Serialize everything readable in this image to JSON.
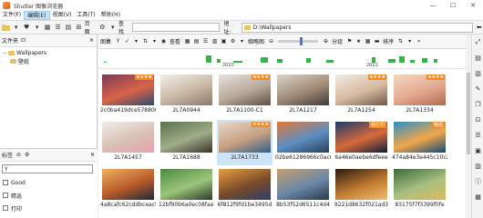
{
  "window": {
    "title": "Shutter 图像浏览器",
    "controls": [
      "—",
      "☐",
      "✕"
    ]
  },
  "menu": [
    "文件(F)",
    "编辑(E)",
    "视图(V)",
    "工具(T)",
    "帮助(H)"
  ],
  "toolbar": {
    "open_label": "",
    "slideshow_label": "",
    "group_label": "页面",
    "search_label": "查找",
    "address_label": "地址:",
    "address_value": "D:\\Wallpapers"
  },
  "folders": {
    "header": "文件夹",
    "items": [
      {
        "label": "Wallpapers",
        "level": 0
      },
      {
        "label": "壁纸",
        "level": 1
      }
    ]
  },
  "tags": {
    "header": "标签",
    "input_value": "",
    "items": [
      {
        "label": "Good"
      },
      {
        "label": "精选"
      },
      {
        "label": "打印"
      }
    ]
  },
  "view_toolbar": {
    "group_label": "图集",
    "view_label": "查看",
    "zoom_label": "缩略图",
    "group2_label": "分组",
    "sort_label": "排序"
  },
  "timeline": {
    "years": [
      "2020",
      "2021"
    ]
  },
  "thumbnails": [
    {
      "caption": "2c0ba419dce578800",
      "colors": [
        "#7a3b55",
        "#d9634a",
        "#2a4a6b"
      ],
      "stars": "★★★★"
    },
    {
      "caption": "2L7A0944",
      "colors": [
        "#f2efe9",
        "#c9b7a5",
        "#8a7a6a"
      ],
      "stars": ""
    },
    {
      "caption": "2L7A1100-C1",
      "colors": [
        "#e8e2dc",
        "#b8a89a",
        "#5e5048"
      ],
      "stars": "★★★★"
    },
    {
      "caption": "2L7A1217",
      "colors": [
        "#dcd3c8",
        "#a08a76",
        "#3e3a38"
      ],
      "stars": ""
    },
    {
      "caption": "2L7A1254",
      "colors": [
        "#f0ece4",
        "#d7b9a0",
        "#6e5a4a"
      ],
      "stars": "★★★★"
    },
    {
      "caption": "2L7A1334",
      "colors": [
        "#f6d8c0",
        "#e3a890",
        "#b06b4f"
      ],
      "stars": "★★★★"
    },
    {
      "caption": "2L7A1457",
      "colors": [
        "#f0ede8",
        "#d8c0b4",
        "#e8a0b0"
      ],
      "stars": ""
    },
    {
      "caption": "2L7A1688",
      "colors": [
        "#5a6f4a",
        "#9fae8a",
        "#3b3028"
      ],
      "stars": ""
    },
    {
      "caption": "2L7A1733",
      "colors": [
        "#e6d9ce",
        "#c79f80",
        "#2d5f8a"
      ],
      "stars": "★★★★"
    },
    {
      "caption": "02be61286966c0ac0",
      "colors": [
        "#e07a3a",
        "#5b8ec2",
        "#2b3e58"
      ],
      "stars": ""
    },
    {
      "caption": "6a46e0aebe6dfeee",
      "colors": [
        "#1a3a6a",
        "#d66a3a",
        "#0e1e38"
      ],
      "stars": "",
      "badge": "待打印"
    },
    {
      "caption": "474a84e3e445c10c2",
      "colors": [
        "#2a8fc4",
        "#f2a64a",
        "#0d4a7a"
      ],
      "stars": "",
      "badge": "精选"
    },
    {
      "caption": "4a8cafc62cddbceac9",
      "colors": [
        "#f0b060",
        "#b85a2a",
        "#1c2a3a"
      ],
      "stars": ""
    },
    {
      "caption": "12bf90b6a0ec08fae1",
      "colors": [
        "#4c8a3c",
        "#9cc47c",
        "#2a3a2a"
      ],
      "stars": ""
    },
    {
      "caption": "6f812f9fd1be3495d",
      "colors": [
        "#e6a040",
        "#7a4a2a",
        "#2a3f6a"
      ],
      "stars": ""
    },
    {
      "caption": "8b53f52d6511c4d4",
      "colors": [
        "#c8a070",
        "#6a88a8",
        "#2a3a4a"
      ],
      "stars": ""
    },
    {
      "caption": "9221d8632f021ad3",
      "colors": [
        "#2a1a10",
        "#c07a30",
        "#f0c070"
      ],
      "stars": ""
    },
    {
      "caption": "83175f7f3399f0fe",
      "colors": [
        "#3c6a3c",
        "#a8c080",
        "#e0b860"
      ],
      "stars": ""
    }
  ]
}
